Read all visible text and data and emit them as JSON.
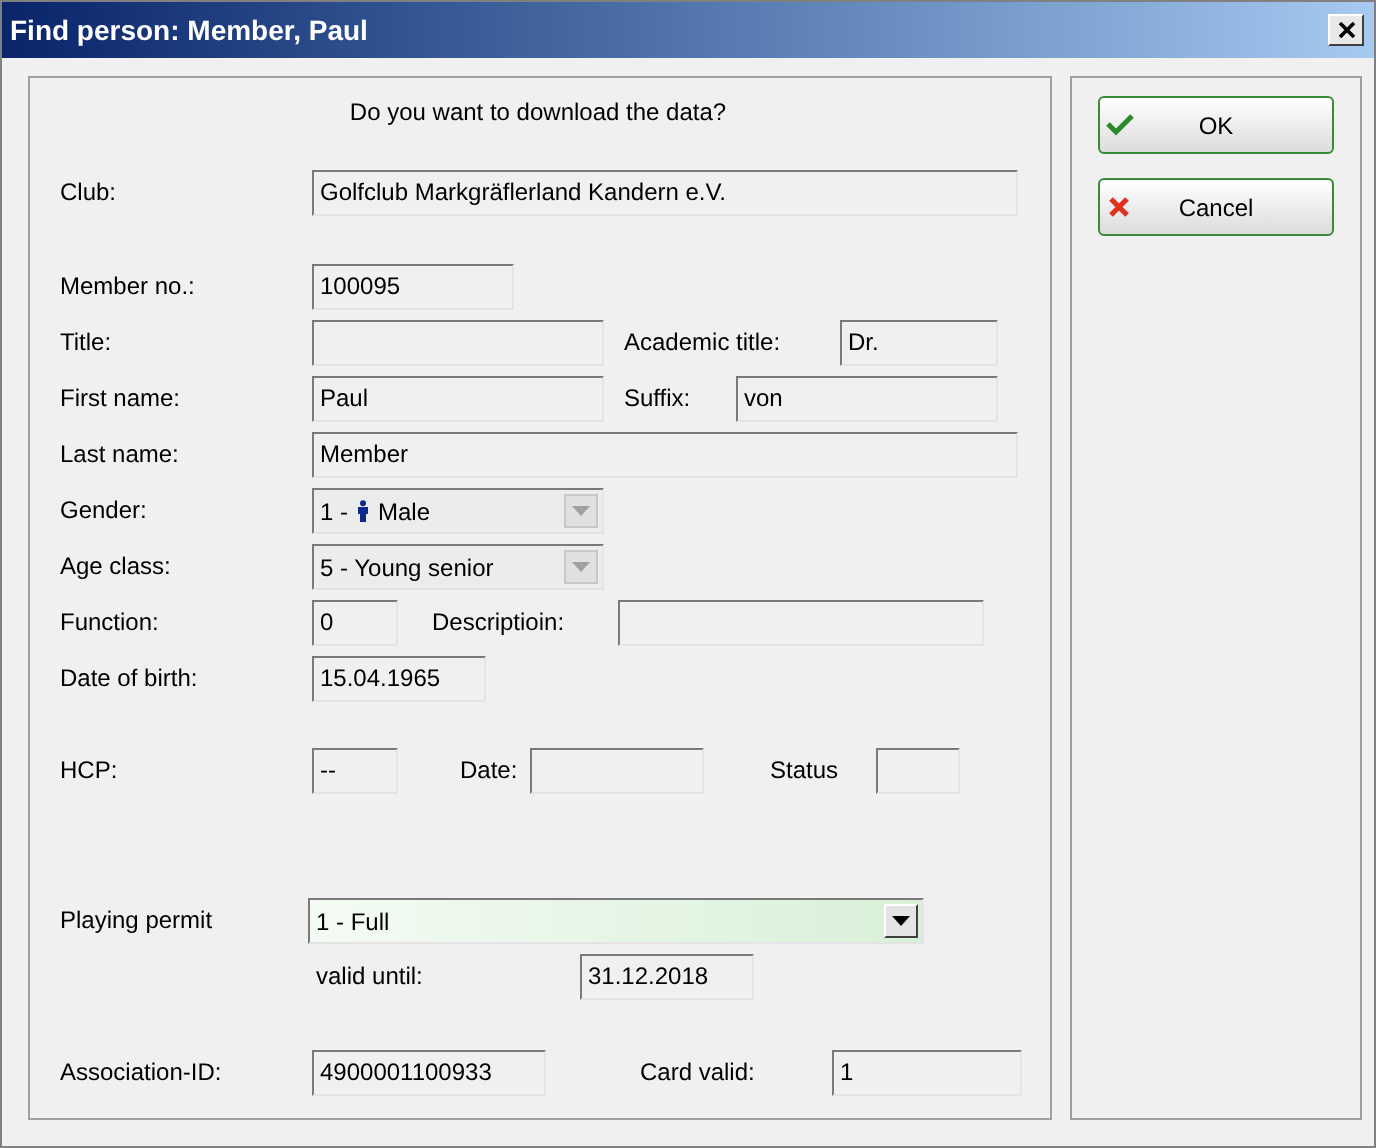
{
  "window": {
    "title": "Find person: Member, Paul"
  },
  "prompt": "Do you want to download the data?",
  "club": {
    "label": "Club:",
    "value": "Golfclub Markgräflerland Kandern e.V."
  },
  "member_no": {
    "label": "Member no.:",
    "value": "100095"
  },
  "title": {
    "label": "Title:"
  },
  "academic_title": {
    "label": "Academic title:",
    "value": "Dr."
  },
  "first_name": {
    "label": "First name:",
    "value": "Paul"
  },
  "suffix": {
    "label": "Suffix:",
    "value": "von"
  },
  "last_name": {
    "label": "Last name:",
    "value": "Member"
  },
  "gender": {
    "label": "Gender:",
    "number": "1 -",
    "value": "Male",
    "disabled": true
  },
  "age_class": {
    "label": "Age class:",
    "value": "5 - Young senior",
    "disabled": true
  },
  "function": {
    "label": "Function:",
    "value": "0"
  },
  "description": {
    "label": "Descriptioin:"
  },
  "date_of_birth": {
    "label": "Date of birth:",
    "value": "15.04.1965"
  },
  "hcp": {
    "label": "HCP:",
    "value": "--"
  },
  "date": {
    "label": "Date:"
  },
  "status": {
    "label": "Status"
  },
  "playing_permit": {
    "label": "Playing permit",
    "value": "1 - Full",
    "disabled": false
  },
  "valid_until": {
    "label": "valid until:",
    "value": "31.12.2018"
  },
  "association_id": {
    "label": "Association-ID:",
    "value": "4900001100933"
  },
  "card_valid": {
    "label": "Card valid:",
    "value": "1"
  },
  "buttons": [
    {
      "kind": "ok",
      "label": "OK"
    },
    {
      "kind": "cancel",
      "label": "Cancel"
    }
  ]
}
